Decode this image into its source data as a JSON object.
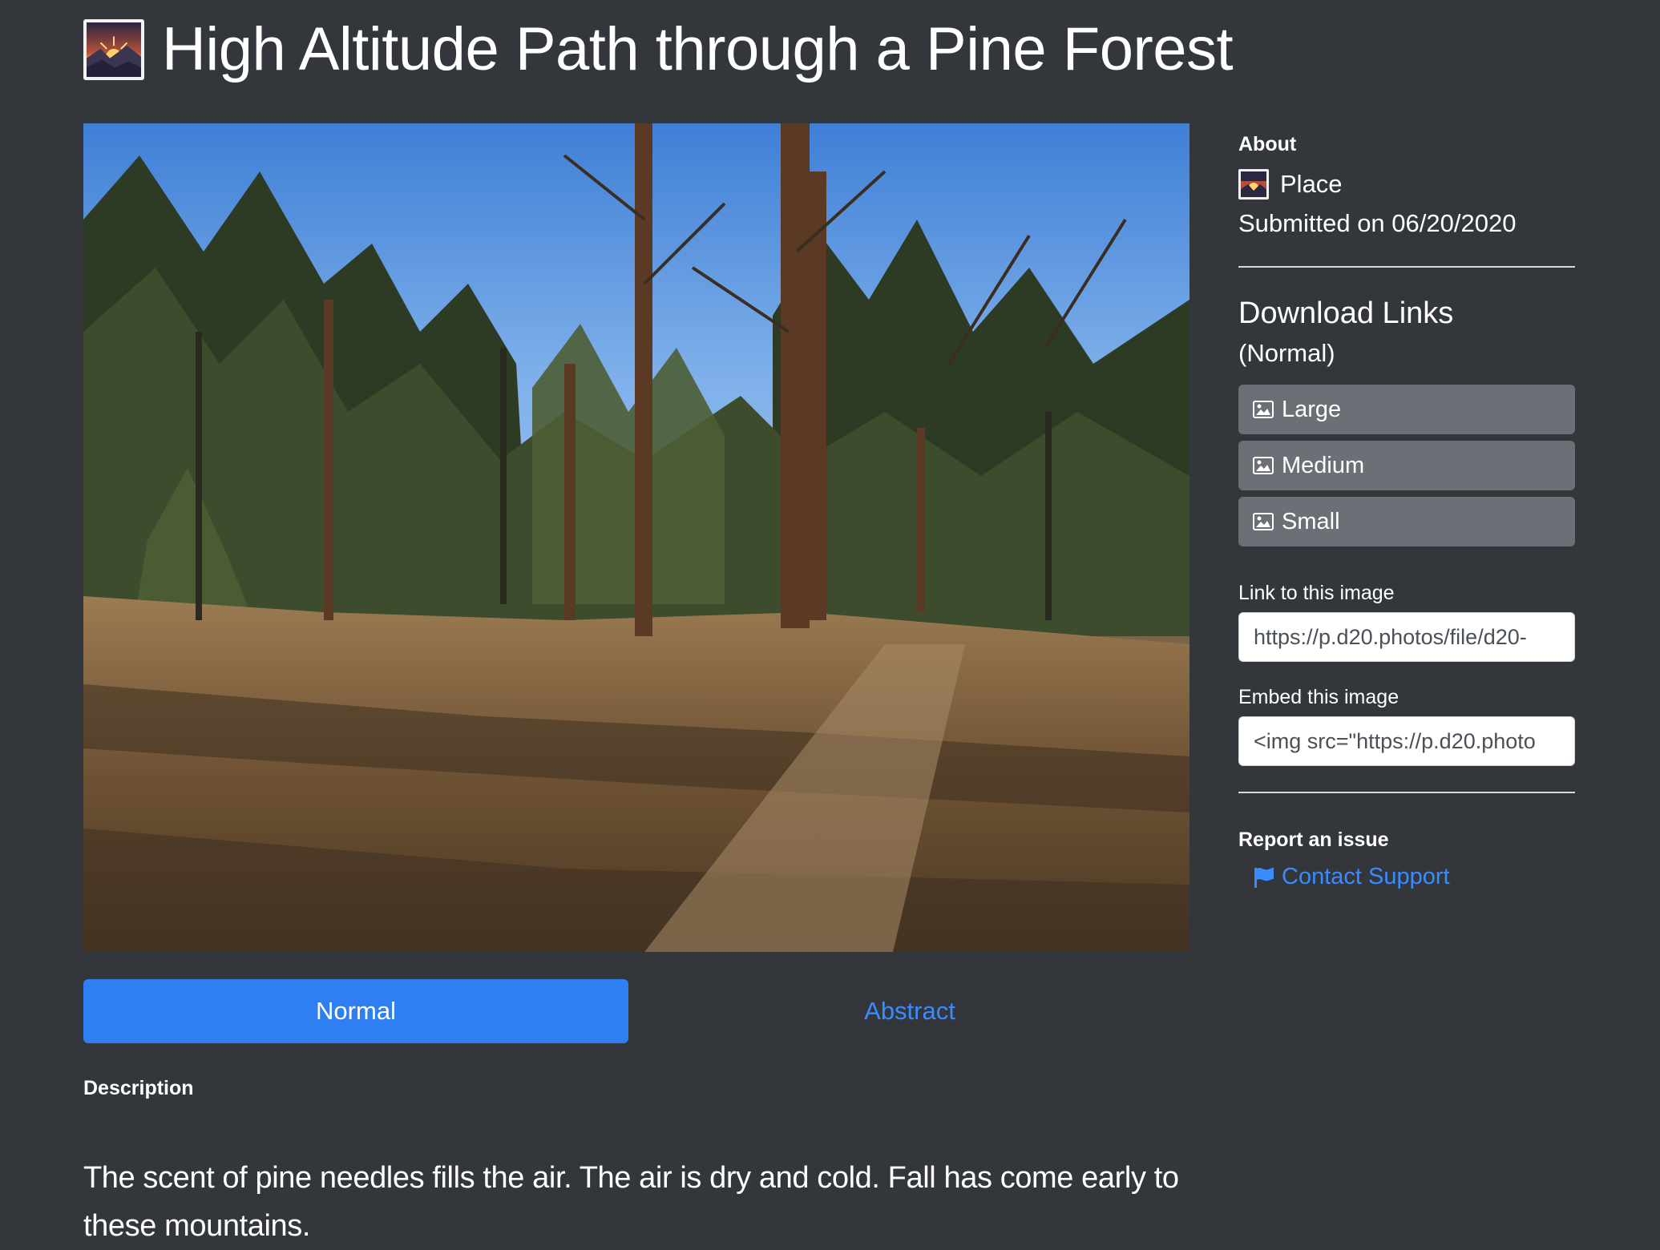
{
  "header": {
    "title": "High Altitude Path through a Pine Forest",
    "icon": "sunrise-mountain-photo-icon"
  },
  "photo": {
    "subject": "forest-trail-photo"
  },
  "tabs": [
    {
      "label": "Normal",
      "active": true
    },
    {
      "label": "Abstract",
      "active": false
    }
  ],
  "description": {
    "heading": "Description",
    "text": "The scent of pine needles fills the air. The air is dry and cold. Fall has come early to these mountains."
  },
  "sidebar": {
    "about": {
      "heading": "About",
      "type": "Place",
      "submitted": "Submitted on 06/20/2020"
    },
    "downloads": {
      "heading": "Download Links",
      "variant": "(Normal)",
      "buttons": [
        {
          "label": "Large",
          "icon": "image-icon"
        },
        {
          "label": "Medium",
          "icon": "image-icon"
        },
        {
          "label": "Small",
          "icon": "image-icon"
        }
      ]
    },
    "link": {
      "label": "Link to this image",
      "value": "https://p.d20.photos/file/d20-"
    },
    "embed": {
      "label": "Embed this image",
      "value": "<img src=\"https://p.d20.photo"
    },
    "report": {
      "heading": "Report an issue",
      "link_label": "Contact Support",
      "icon": "flag-icon"
    }
  },
  "colors": {
    "background": "#33373c",
    "accent": "#2f7ff3",
    "link": "#3a8bff",
    "button_gray": "#6c6f75"
  }
}
